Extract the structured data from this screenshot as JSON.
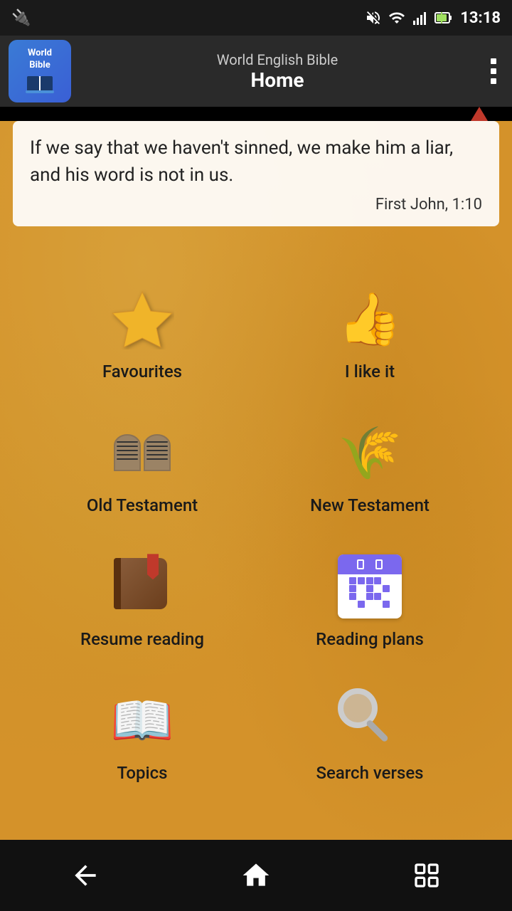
{
  "statusBar": {
    "time": "13:18",
    "usbIcon": "⚡"
  },
  "appBar": {
    "appIconLine1": "World",
    "appIconLine2": "Bible",
    "subtitle": "World English Bible",
    "title": "Home"
  },
  "quote": {
    "text": "If we say that we haven't sinned, we make him a liar, and his word is not in us.",
    "reference": "First John, 1:10"
  },
  "grid": {
    "items": [
      {
        "id": "favourites",
        "label": "Favourites",
        "iconType": "star"
      },
      {
        "id": "i-like-it",
        "label": "I like it",
        "iconType": "thumbs"
      },
      {
        "id": "old-testament",
        "label": "Old Testament",
        "iconType": "tablets"
      },
      {
        "id": "new-testament",
        "label": "New Testament",
        "iconType": "wheat"
      },
      {
        "id": "resume-reading",
        "label": "Resume reading",
        "iconType": "book"
      },
      {
        "id": "reading-plans",
        "label": "Reading plans",
        "iconType": "calendar"
      },
      {
        "id": "topics",
        "label": "Topics",
        "iconType": "openbook"
      },
      {
        "id": "search-verses",
        "label": "Search verses",
        "iconType": "magnifier"
      }
    ]
  },
  "bottomNav": {
    "backLabel": "back",
    "homeLabel": "home",
    "recentLabel": "recent"
  }
}
